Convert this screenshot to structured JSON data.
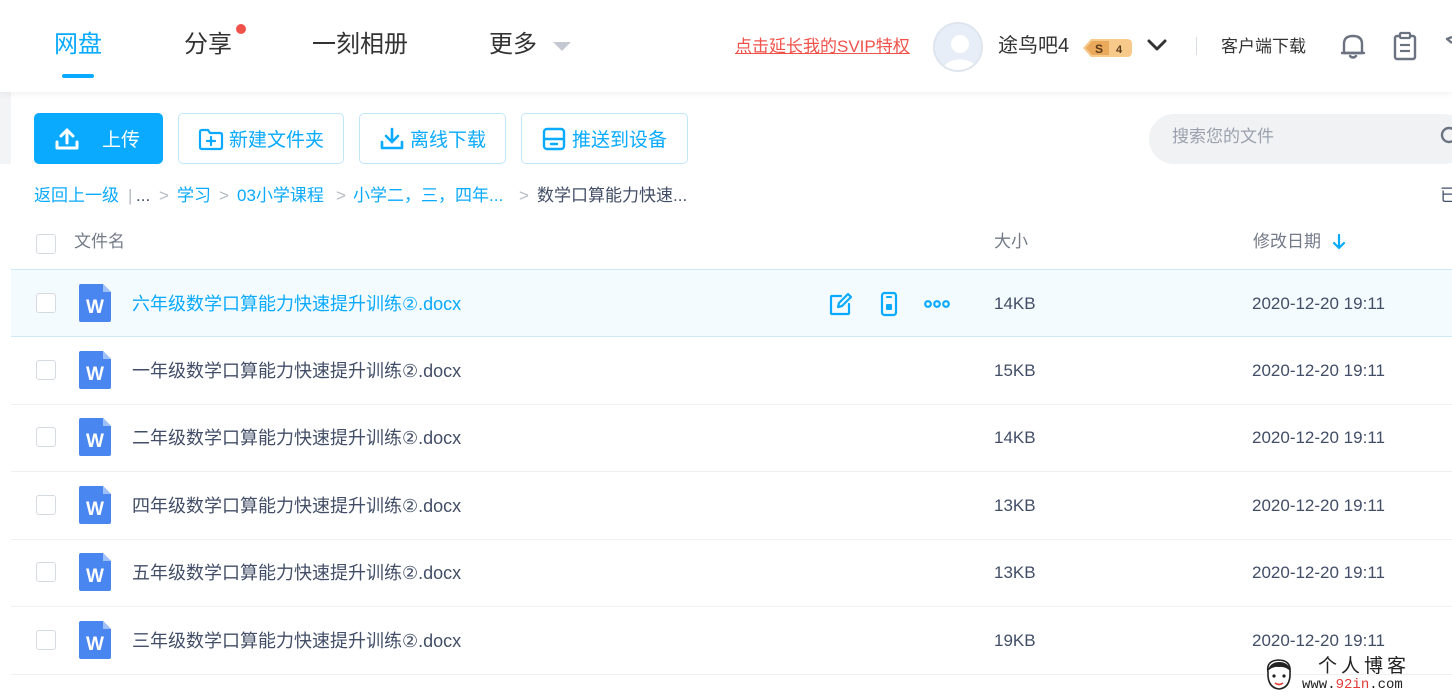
{
  "nav": {
    "items": [
      {
        "label": "网盘",
        "active": true
      },
      {
        "label": "分享",
        "has_dot": true
      },
      {
        "label": "一刻相册"
      },
      {
        "label": "更多",
        "dropdown": true
      }
    ]
  },
  "header": {
    "svip_link": "点击延长我的SVIP特权",
    "username": "途鸟吧4",
    "vip_badge": {
      "letter": "S",
      "level": "4"
    },
    "client_download": "客户端下载",
    "icons": [
      "avatar",
      "chevron-down-icon",
      "bell-icon",
      "clipboard-icon"
    ]
  },
  "toolbar": {
    "upload": "上传",
    "new_folder": "新建文件夹",
    "offline_download": "离线下载",
    "push_to_device": "推送到设备"
  },
  "search": {
    "placeholder": "搜索您的文件"
  },
  "breadcrumb": {
    "back": "返回上一级",
    "divider": "|",
    "ellipsis": "...",
    "separator": ">",
    "items": [
      "学习",
      "03小学课程",
      "小学二，三，四年...",
      "数学口算能力快速..."
    ],
    "right_edge": "已"
  },
  "table": {
    "headers": {
      "name": "文件名",
      "size": "大小",
      "modified": "修改日期"
    },
    "sort_icon": "arrow-down-icon",
    "rows": [
      {
        "name": "六年级数学口算能力快速提升训练②.docx",
        "size": "14KB",
        "modified": "2020-12-20 19:11",
        "hover": true
      },
      {
        "name": "一年级数学口算能力快速提升训练②.docx",
        "size": "15KB",
        "modified": "2020-12-20 19:11"
      },
      {
        "name": "二年级数学口算能力快速提升训练②.docx",
        "size": "14KB",
        "modified": "2020-12-20 19:11"
      },
      {
        "name": "四年级数学口算能力快速提升训练②.docx",
        "size": "13KB",
        "modified": "2020-12-20 19:11"
      },
      {
        "name": "五年级数学口算能力快速提升训练②.docx",
        "size": "13KB",
        "modified": "2020-12-20 19:11"
      },
      {
        "name": "三年级数学口算能力快速提升训练②.docx",
        "size": "19KB",
        "modified": "2020-12-20 19:11"
      }
    ],
    "row_actions": [
      "edit-icon",
      "phone-icon",
      "more-icon"
    ],
    "file_icon": "word-doc-icon",
    "file_icon_letter": "W"
  },
  "watermark": {
    "title": "个人博客",
    "url_prefix": "www.",
    "url_highlight": "92in",
    "url_suffix": ".com"
  },
  "colors": {
    "accent": "#09aaff",
    "danger": "#f0524a",
    "text": "#424e67",
    "word_icon": "#4a86f0"
  }
}
